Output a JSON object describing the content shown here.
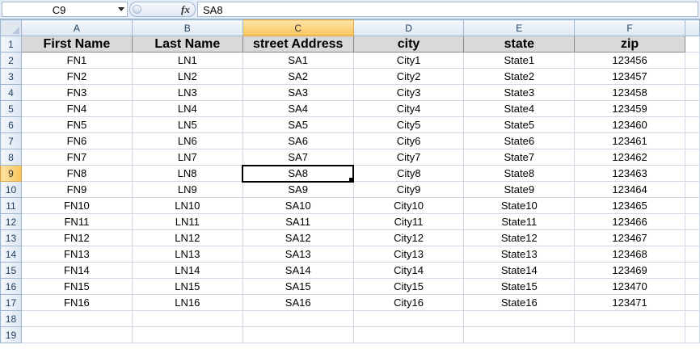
{
  "formula_bar": {
    "name_box": "C9",
    "fx_icon": "fx-icon",
    "formula": "SA8"
  },
  "selection": {
    "column": "C",
    "row": 9
  },
  "columns": [
    "A",
    "B",
    "C",
    "D",
    "E",
    "F"
  ],
  "rows": [
    "1",
    "2",
    "3",
    "4",
    "5",
    "6",
    "7",
    "8",
    "9",
    "10",
    "11",
    "12",
    "13",
    "14",
    "15",
    "16",
    "17",
    "18",
    "19"
  ],
  "headers": [
    "First Name",
    "Last Name",
    "street Address",
    "city",
    "state",
    "zip"
  ],
  "records": [
    [
      "FN1",
      "LN1",
      "SA1",
      "City1",
      "State1",
      "123456"
    ],
    [
      "FN2",
      "LN2",
      "SA2",
      "City2",
      "State2",
      "123457"
    ],
    [
      "FN3",
      "LN3",
      "SA3",
      "City3",
      "State3",
      "123458"
    ],
    [
      "FN4",
      "LN4",
      "SA4",
      "City4",
      "State4",
      "123459"
    ],
    [
      "FN5",
      "LN5",
      "SA5",
      "City5",
      "State5",
      "123460"
    ],
    [
      "FN6",
      "LN6",
      "SA6",
      "City6",
      "State6",
      "123461"
    ],
    [
      "FN7",
      "LN7",
      "SA7",
      "City7",
      "State7",
      "123462"
    ],
    [
      "FN8",
      "LN8",
      "SA8",
      "City8",
      "State8",
      "123463"
    ],
    [
      "FN9",
      "LN9",
      "SA9",
      "City9",
      "State9",
      "123464"
    ],
    [
      "FN10",
      "LN10",
      "SA10",
      "City10",
      "State10",
      "123465"
    ],
    [
      "FN11",
      "LN11",
      "SA11",
      "City11",
      "State11",
      "123466"
    ],
    [
      "FN12",
      "LN12",
      "SA12",
      "City12",
      "State12",
      "123467"
    ],
    [
      "FN13",
      "LN13",
      "SA13",
      "City13",
      "State13",
      "123468"
    ],
    [
      "FN14",
      "LN14",
      "SA14",
      "City14",
      "State14",
      "123469"
    ],
    [
      "FN15",
      "LN15",
      "SA15",
      "City15",
      "State15",
      "123470"
    ],
    [
      "FN16",
      "LN16",
      "SA16",
      "City16",
      "State16",
      "123471"
    ]
  ],
  "colors": {
    "header_fill": "#d9d9d9",
    "selection_header": "#f8c45b",
    "gridline": "#d0d7e5"
  }
}
